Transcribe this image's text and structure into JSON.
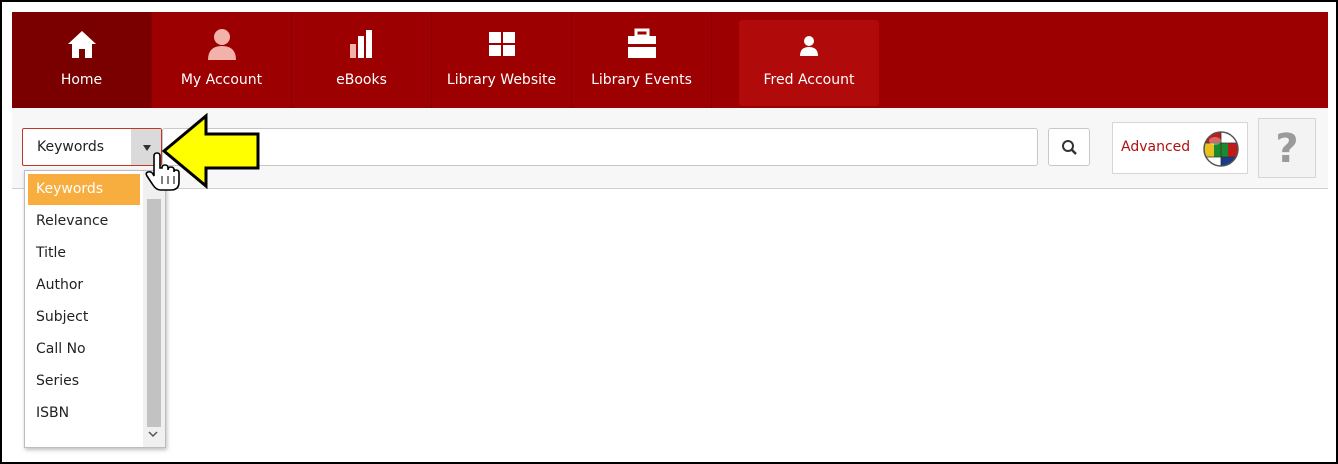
{
  "nav": {
    "items": [
      {
        "label": "Home",
        "icon": "home-icon"
      },
      {
        "label": "My Account",
        "icon": "user-icon"
      },
      {
        "label": "eBooks",
        "icon": "bar-chart-icon"
      },
      {
        "label": "Library Website",
        "icon": "grid-icon"
      },
      {
        "label": "Library Events",
        "icon": "briefcase-icon"
      }
    ],
    "account": {
      "label": "Fred Account",
      "icon": "user-small-icon"
    }
  },
  "search": {
    "scope_value": "Keywords",
    "query": "",
    "advanced_label": "Advanced",
    "help_label": "?"
  },
  "dropdown": {
    "options": [
      "Keywords",
      "Relevance",
      "Title",
      "Author",
      "Subject",
      "Call No",
      "Series",
      "ISBN"
    ],
    "selected": "Keywords"
  },
  "colors": {
    "nav_bg": "#9c0000",
    "accent": "#f7ae3f",
    "link_red": "#b01010",
    "pointer_yellow": "#ffff00"
  }
}
